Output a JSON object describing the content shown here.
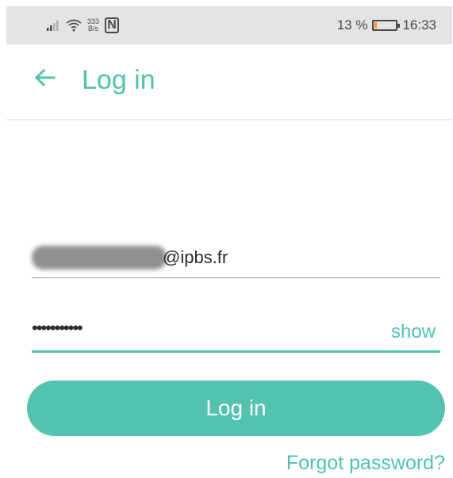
{
  "statusbar": {
    "net_speed_value": "333",
    "net_speed_unit": "B/s",
    "nfc_glyph": "N",
    "battery_percent": "13 %",
    "battery_level": 0.13,
    "time": "16:33",
    "battery_fill_color": "#f39a1e"
  },
  "appbar": {
    "back_icon": "arrow-left-icon",
    "title": "Log in"
  },
  "form": {
    "email_visible_suffix": "@ipbs.fr",
    "password_masked": "•••••••••••",
    "show_label": "show"
  },
  "login_button_label": "Log in",
  "forgot_password_label": "Forgot password?",
  "colors": {
    "accent": "#4fc3ae",
    "button": "#53c3b0"
  }
}
